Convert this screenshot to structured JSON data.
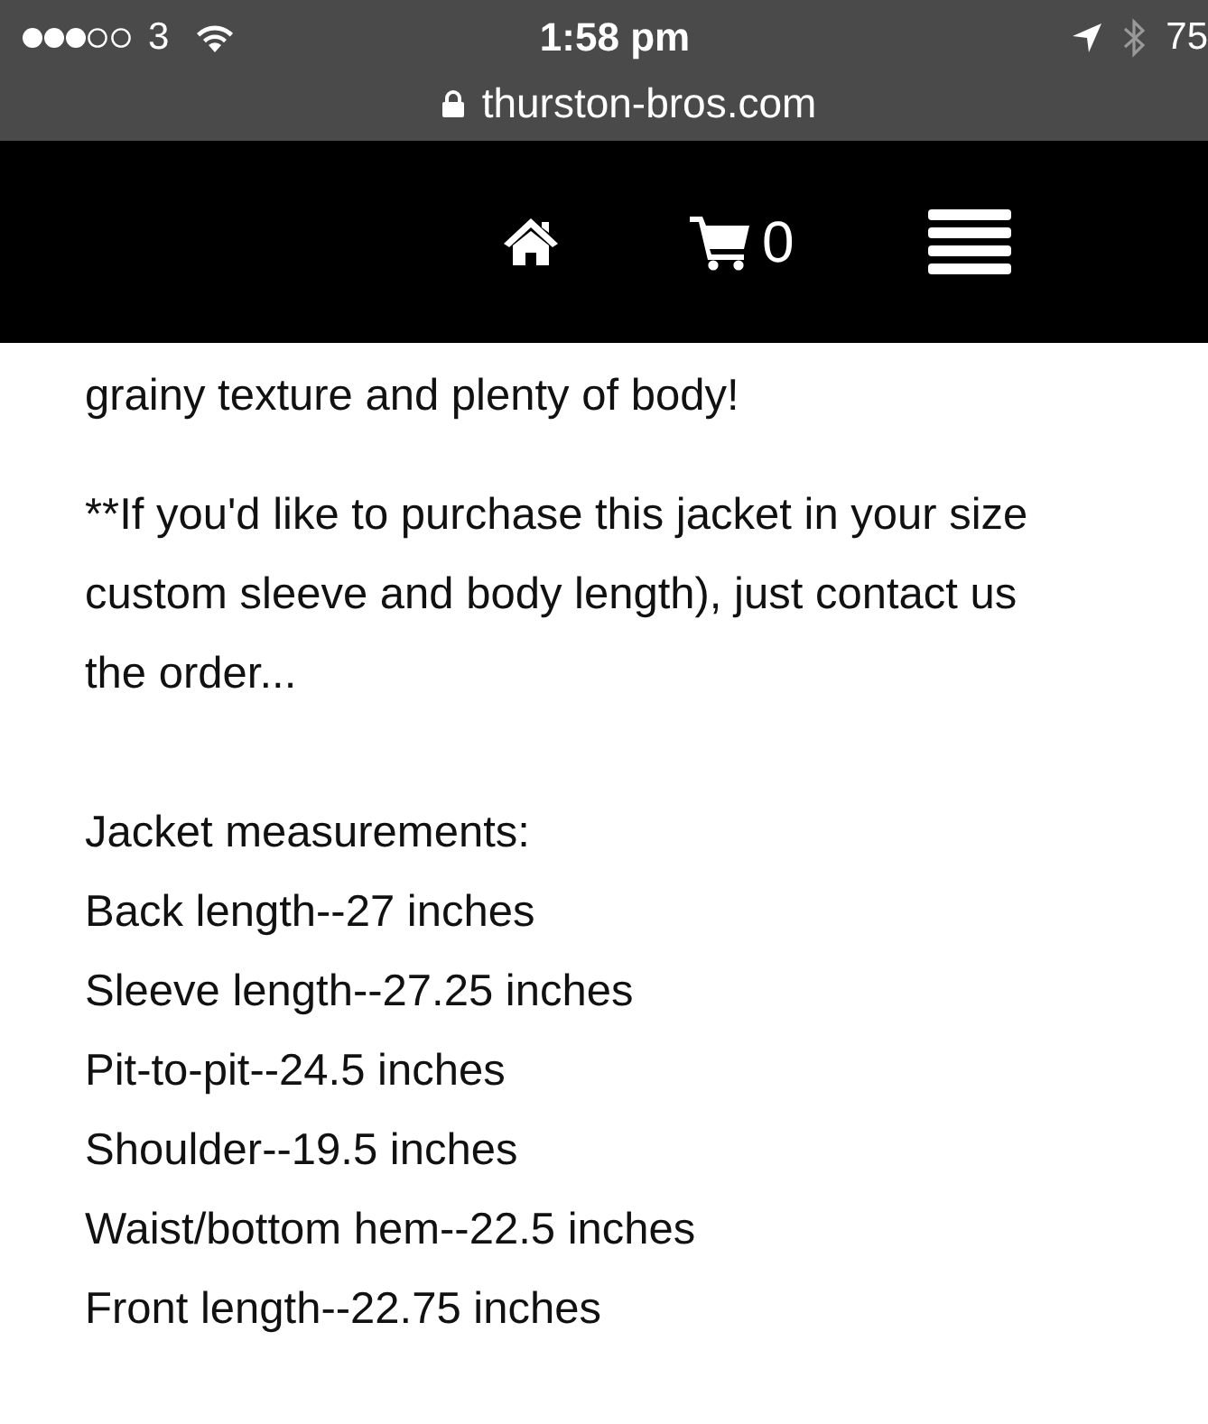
{
  "status_bar": {
    "carrier": "3",
    "time": "1:58 pm",
    "battery": "75"
  },
  "address_bar": {
    "url": "thurston-bros.com"
  },
  "nav": {
    "cart_count": "0"
  },
  "content": {
    "paragraphs": [
      [
        "grainy texture and plenty of body!"
      ],
      [
        "**If you'd like to purchase this jacket in your size",
        "custom sleeve and body length), just contact us",
        "the order..."
      ],
      [
        "Jacket measurements:",
        "Back length--27 inches",
        "Sleeve length--27.25 inches",
        "Pit-to-pit--24.5 inches",
        "Shoulder--19.5 inches",
        "Waist/bottom hem--22.5 inches",
        "Front length--22.75 inches"
      ]
    ]
  }
}
